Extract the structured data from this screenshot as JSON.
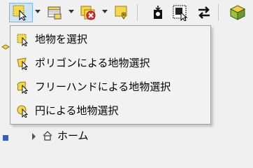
{
  "toolbar": {
    "icons": [
      "select-features-icon",
      "select-dropdown-arrow-icon",
      "attribute-table-icon",
      "deselect-features-icon",
      "select-by-location-icon",
      "identify-feature-icon",
      "select-by-extent-icon",
      "switch-direction-icon",
      "plugin-cube-icon"
    ]
  },
  "menu": {
    "items": [
      {
        "label": "地物を選択",
        "icon": "select-features-icon"
      },
      {
        "label": "ポリゴンによる地物選択",
        "icon": "select-by-polygon-icon"
      },
      {
        "label": "フリーハンドによる地物選択",
        "icon": "select-freehand-icon"
      },
      {
        "label": "円による地物選択",
        "icon": "select-by-radius-icon"
      }
    ]
  },
  "tree": {
    "home_label": "ホーム"
  },
  "colors": {
    "menu_bg": "#f2f2f2",
    "active_button_bg": "#cde4f7",
    "active_button_border": "#7eb4ea",
    "selection_yellow": "#f5d94a",
    "selection_green": "#d6e06a"
  }
}
